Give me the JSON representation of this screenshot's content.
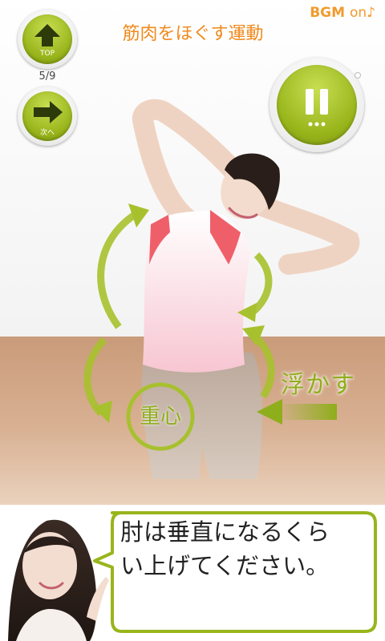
{
  "header": {
    "title": "筋肉をほぐす運動",
    "bgm_label": "BGM",
    "bgm_state": "on♪"
  },
  "nav": {
    "top_label": "TOP",
    "counter": "5/9",
    "next_label": "次へ"
  },
  "illustration": {
    "float_label": "浮かす",
    "center_label": "重心"
  },
  "instruction": {
    "line1": "肘は垂直になるくら",
    "line2": "い上げてください。"
  },
  "colors": {
    "accent_green": "#98b51b",
    "title_orange": "#f08a1e"
  },
  "icons": {
    "top": "arrow-up-icon",
    "next": "arrow-right-icon",
    "pause": "pause-icon"
  }
}
